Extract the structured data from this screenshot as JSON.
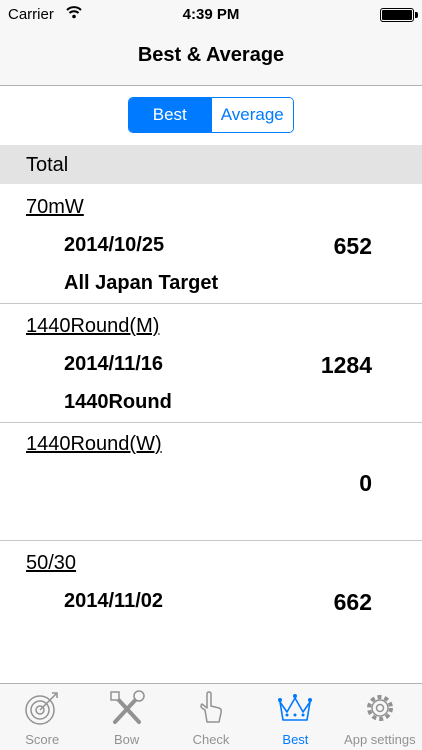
{
  "status": {
    "carrier": "Carrier",
    "time": "4:39 PM"
  },
  "nav": {
    "title": "Best & Average"
  },
  "segment": {
    "best": "Best",
    "average": "Average"
  },
  "section": {
    "title": "Total"
  },
  "rows": [
    {
      "category": "70mW",
      "date": "2014/10/25",
      "round": "All Japan Target",
      "score": "652"
    },
    {
      "category": "1440Round(M)",
      "date": "2014/11/16",
      "round": "1440Round",
      "score": "1284"
    },
    {
      "category": "1440Round(W)",
      "date": "",
      "round": "",
      "score": "0"
    },
    {
      "category": "50/30",
      "date": "2014/11/02",
      "round": "",
      "score": "662"
    }
  ],
  "tabs": [
    {
      "label": "Score",
      "icon": "target-icon"
    },
    {
      "label": "Bow",
      "icon": "tools-icon"
    },
    {
      "label": "Check",
      "icon": "hand-pointer-icon"
    },
    {
      "label": "Best",
      "icon": "crown-icon"
    },
    {
      "label": "App settings",
      "icon": "gear-icon"
    }
  ],
  "colors": {
    "accent": "#007aff",
    "inactive": "#929292",
    "section_bg": "#e3e3e3"
  }
}
